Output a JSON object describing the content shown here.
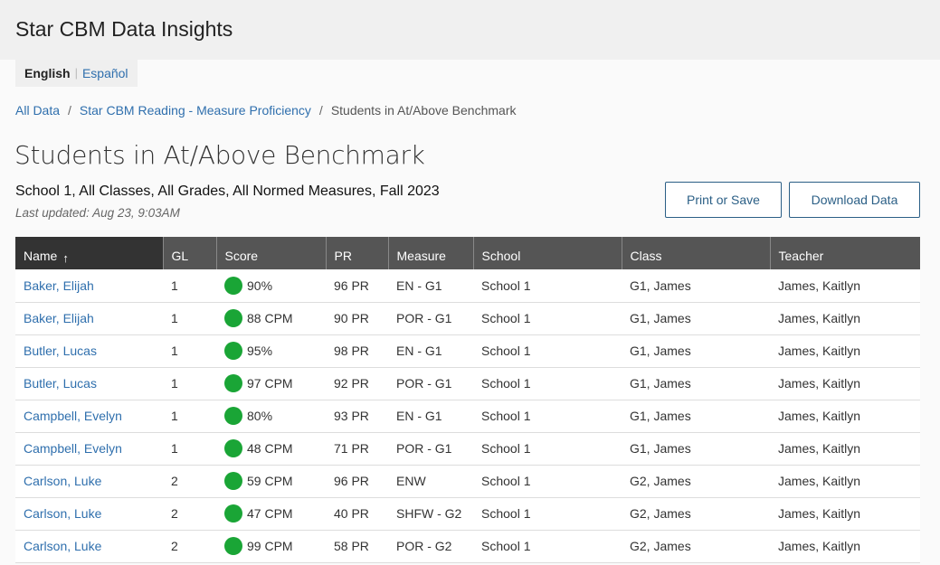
{
  "app": {
    "title": "Star CBM Data Insights"
  },
  "language": {
    "active": "English",
    "separator": "|",
    "other": "Español"
  },
  "breadcrumb": {
    "items": [
      "All Data",
      "Star CBM Reading - Measure Proficiency"
    ],
    "separator": "/",
    "current": "Students in At/Above Benchmark"
  },
  "page": {
    "title": "Students in At/Above Benchmark",
    "filters": "School 1, All Classes, All Grades, All Normed Measures, Fall 2023",
    "last_updated": "Last updated: Aug 23, 9:03AM"
  },
  "actions": {
    "print_label": "Print or Save",
    "download_label": "Download Data"
  },
  "colors": {
    "benchmark_green": "#1aa536",
    "link": "#2f6fad",
    "header_bg": "#555555"
  },
  "table": {
    "columns": [
      "Name",
      "GL",
      "Score",
      "PR",
      "Measure",
      "School",
      "Class",
      "Teacher"
    ],
    "sort_icon": "arrow-up-icon",
    "rows": [
      {
        "name": "Baker, Elijah",
        "gl": "1",
        "score": "90%",
        "pr": "96 PR",
        "measure": "EN - G1",
        "school": "School 1",
        "class": "G1, James",
        "teacher": "James, Kaitlyn"
      },
      {
        "name": "Baker, Elijah",
        "gl": "1",
        "score": "88 CPM",
        "pr": "90 PR",
        "measure": "POR - G1",
        "school": "School 1",
        "class": "G1, James",
        "teacher": "James, Kaitlyn"
      },
      {
        "name": "Butler, Lucas",
        "gl": "1",
        "score": "95%",
        "pr": "98 PR",
        "measure": "EN - G1",
        "school": "School 1",
        "class": "G1, James",
        "teacher": "James, Kaitlyn"
      },
      {
        "name": "Butler, Lucas",
        "gl": "1",
        "score": "97 CPM",
        "pr": "92 PR",
        "measure": "POR - G1",
        "school": "School 1",
        "class": "G1, James",
        "teacher": "James, Kaitlyn"
      },
      {
        "name": "Campbell, Evelyn",
        "gl": "1",
        "score": "80%",
        "pr": "93 PR",
        "measure": "EN - G1",
        "school": "School 1",
        "class": "G1, James",
        "teacher": "James, Kaitlyn"
      },
      {
        "name": "Campbell, Evelyn",
        "gl": "1",
        "score": "48 CPM",
        "pr": "71 PR",
        "measure": "POR - G1",
        "school": "School 1",
        "class": "G1, James",
        "teacher": "James, Kaitlyn"
      },
      {
        "name": "Carlson, Luke",
        "gl": "2",
        "score": "59 CPM",
        "pr": "96 PR",
        "measure": "ENW",
        "school": "School 1",
        "class": "G2, James",
        "teacher": "James, Kaitlyn"
      },
      {
        "name": "Carlson, Luke",
        "gl": "2",
        "score": "47 CPM",
        "pr": "40 PR",
        "measure": "SHFW - G2",
        "school": "School 1",
        "class": "G2, James",
        "teacher": "James, Kaitlyn"
      },
      {
        "name": "Carlson, Luke",
        "gl": "2",
        "score": "99 CPM",
        "pr": "58 PR",
        "measure": "POR - G2",
        "school": "School 1",
        "class": "G2, James",
        "teacher": "James, Kaitlyn"
      }
    ]
  }
}
